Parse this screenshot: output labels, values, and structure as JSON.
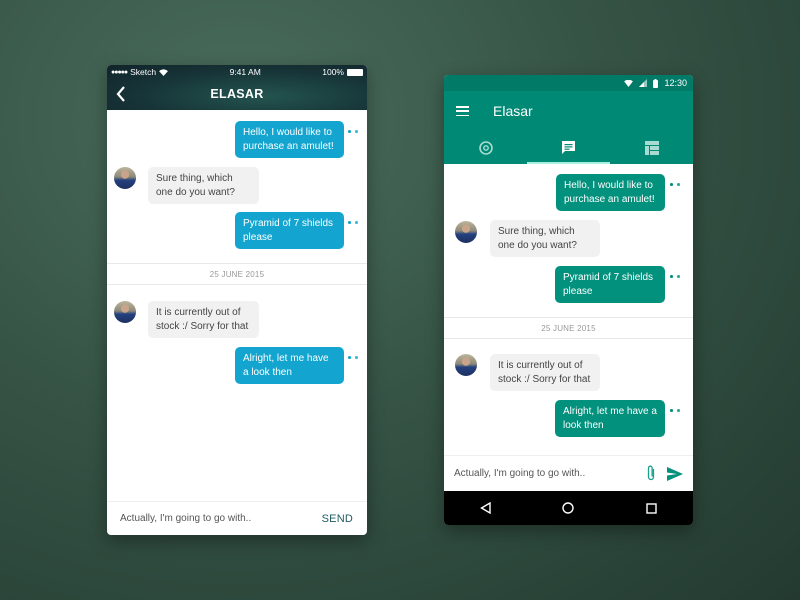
{
  "colors": {
    "ios_outgoing": "#13a5cf",
    "android_outgoing": "#01917c",
    "incoming": "#f1f1f1",
    "android_primary": "#008a76",
    "tab_indicator": "#a9f0e1"
  },
  "ios": {
    "status": {
      "carrier": "Sketch",
      "time": "9:41 AM",
      "battery": "100%"
    },
    "title": "ELASAR",
    "messages": [
      {
        "dir": "out",
        "text": "Hello, I would like to purchase an amulet!"
      },
      {
        "dir": "in",
        "text": "Sure thing, which one do you want?"
      },
      {
        "dir": "out",
        "text": "Pyramid of 7 shields please"
      },
      {
        "dir": "in",
        "text": "It is currently out of stock :/ Sorry for that"
      },
      {
        "dir": "out",
        "text": "Alright, let me have a look then"
      }
    ],
    "date_divider": "25 JUNE 2015",
    "input": {
      "value": "Actually, I'm going to go with..",
      "send_label": "SEND"
    }
  },
  "android": {
    "status": {
      "time": "12:30"
    },
    "title": "Elasar",
    "tabs": [
      {
        "icon": "explore-icon",
        "active": false
      },
      {
        "icon": "chat-icon",
        "active": true
      },
      {
        "icon": "dashboard-icon",
        "active": false
      }
    ],
    "messages": [
      {
        "dir": "out",
        "text": "Hello, I would like to purchase an amulet!"
      },
      {
        "dir": "in",
        "text": "Sure thing, which one do you want?"
      },
      {
        "dir": "out",
        "text": "Pyramid of 7 shields please"
      },
      {
        "dir": "in",
        "text": "It is currently out of stock :/ Sorry for that"
      },
      {
        "dir": "out",
        "text": "Alright, let me have a look then"
      }
    ],
    "date_divider": "25 JUNE 2015",
    "input": {
      "value": "Actually, I'm going to go with.."
    }
  }
}
